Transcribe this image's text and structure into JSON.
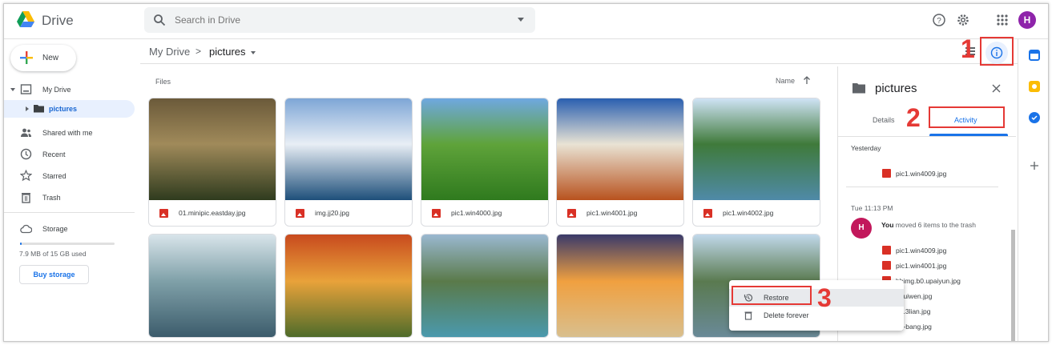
{
  "app": {
    "name": "Drive"
  },
  "search": {
    "placeholder": "Search in Drive"
  },
  "new_button": {
    "label": "New"
  },
  "nav": {
    "my_drive": "My Drive",
    "pictures": "pictures",
    "shared": "Shared with me",
    "recent": "Recent",
    "starred": "Starred",
    "trash": "Trash",
    "storage": "Storage",
    "storage_used": "7.9 MB of 15 GB used",
    "storage_fraction": 0.0005,
    "buy_storage": "Buy storage"
  },
  "breadcrumb": {
    "root": "My Drive",
    "sep": ">",
    "current": "pictures"
  },
  "files_header": {
    "label": "Files",
    "sort": "Name"
  },
  "files": [
    {
      "name": "01.minipic.eastday.jpg",
      "colors": [
        "#6b5a3a",
        "#a08a5a",
        "#2f3b1e"
      ]
    },
    {
      "name": "img.jj20.jpg",
      "colors": [
        "#7ea6d6",
        "#e8eef5",
        "#1e4f7a"
      ]
    },
    {
      "name": "pic1.win4000.jpg",
      "colors": [
        "#6fa8e0",
        "#5fa33a",
        "#2f7a1e"
      ]
    },
    {
      "name": "pic1.win4001.jpg",
      "colors": [
        "#2a5fb0",
        "#e9e3d4",
        "#b8521e"
      ]
    },
    {
      "name": "pic1.win4002.jpg",
      "colors": [
        "#cfe3f5",
        "#3f7a3a",
        "#4f8aa8"
      ]
    },
    {
      "name": "",
      "colors": [
        "#d8e4ea",
        "#7fa0a8",
        "#3a5a6a"
      ]
    },
    {
      "name": "",
      "colors": [
        "#c84a1e",
        "#e8a23a",
        "#4a6a2a"
      ]
    },
    {
      "name": "",
      "colors": [
        "#9ab8d0",
        "#5a7a4a",
        "#4a9ab0"
      ]
    },
    {
      "name": "",
      "colors": [
        "#3a3a6a",
        "#f0a040",
        "#d8c090"
      ]
    },
    {
      "name": "",
      "colors": [
        "#c0d8ea",
        "#5a7a50",
        "#6a8a9a"
      ]
    }
  ],
  "panel": {
    "title": "pictures",
    "tabs": [
      "Details",
      "Activity"
    ],
    "active_tab": "Activity",
    "group1": "Yesterday",
    "group1_files": [
      "pic1.win4009.jpg"
    ],
    "group2": "Tue 11:13 PM",
    "avatar": "H",
    "actor": "You",
    "action": " moved 6 items to the trash",
    "group2_files": [
      "pic1.win4009.jpg",
      "pic1.win4001.jpg",
      "bbimg.b0.upaiyun.jpg",
      "c.ruiwen.jpg",
      "g1.3lian.jpg",
      "ng-bang.jpg"
    ]
  },
  "context_menu": {
    "restore": "Restore",
    "delete": "Delete forever"
  },
  "annotations": [
    "1",
    "2",
    "3"
  ],
  "user": {
    "initial": "H"
  },
  "colors": {
    "accent": "#1a73e8",
    "annotation": "#e53935",
    "avatar": "#8e24aa",
    "activity_avatar": "#c2185b"
  }
}
